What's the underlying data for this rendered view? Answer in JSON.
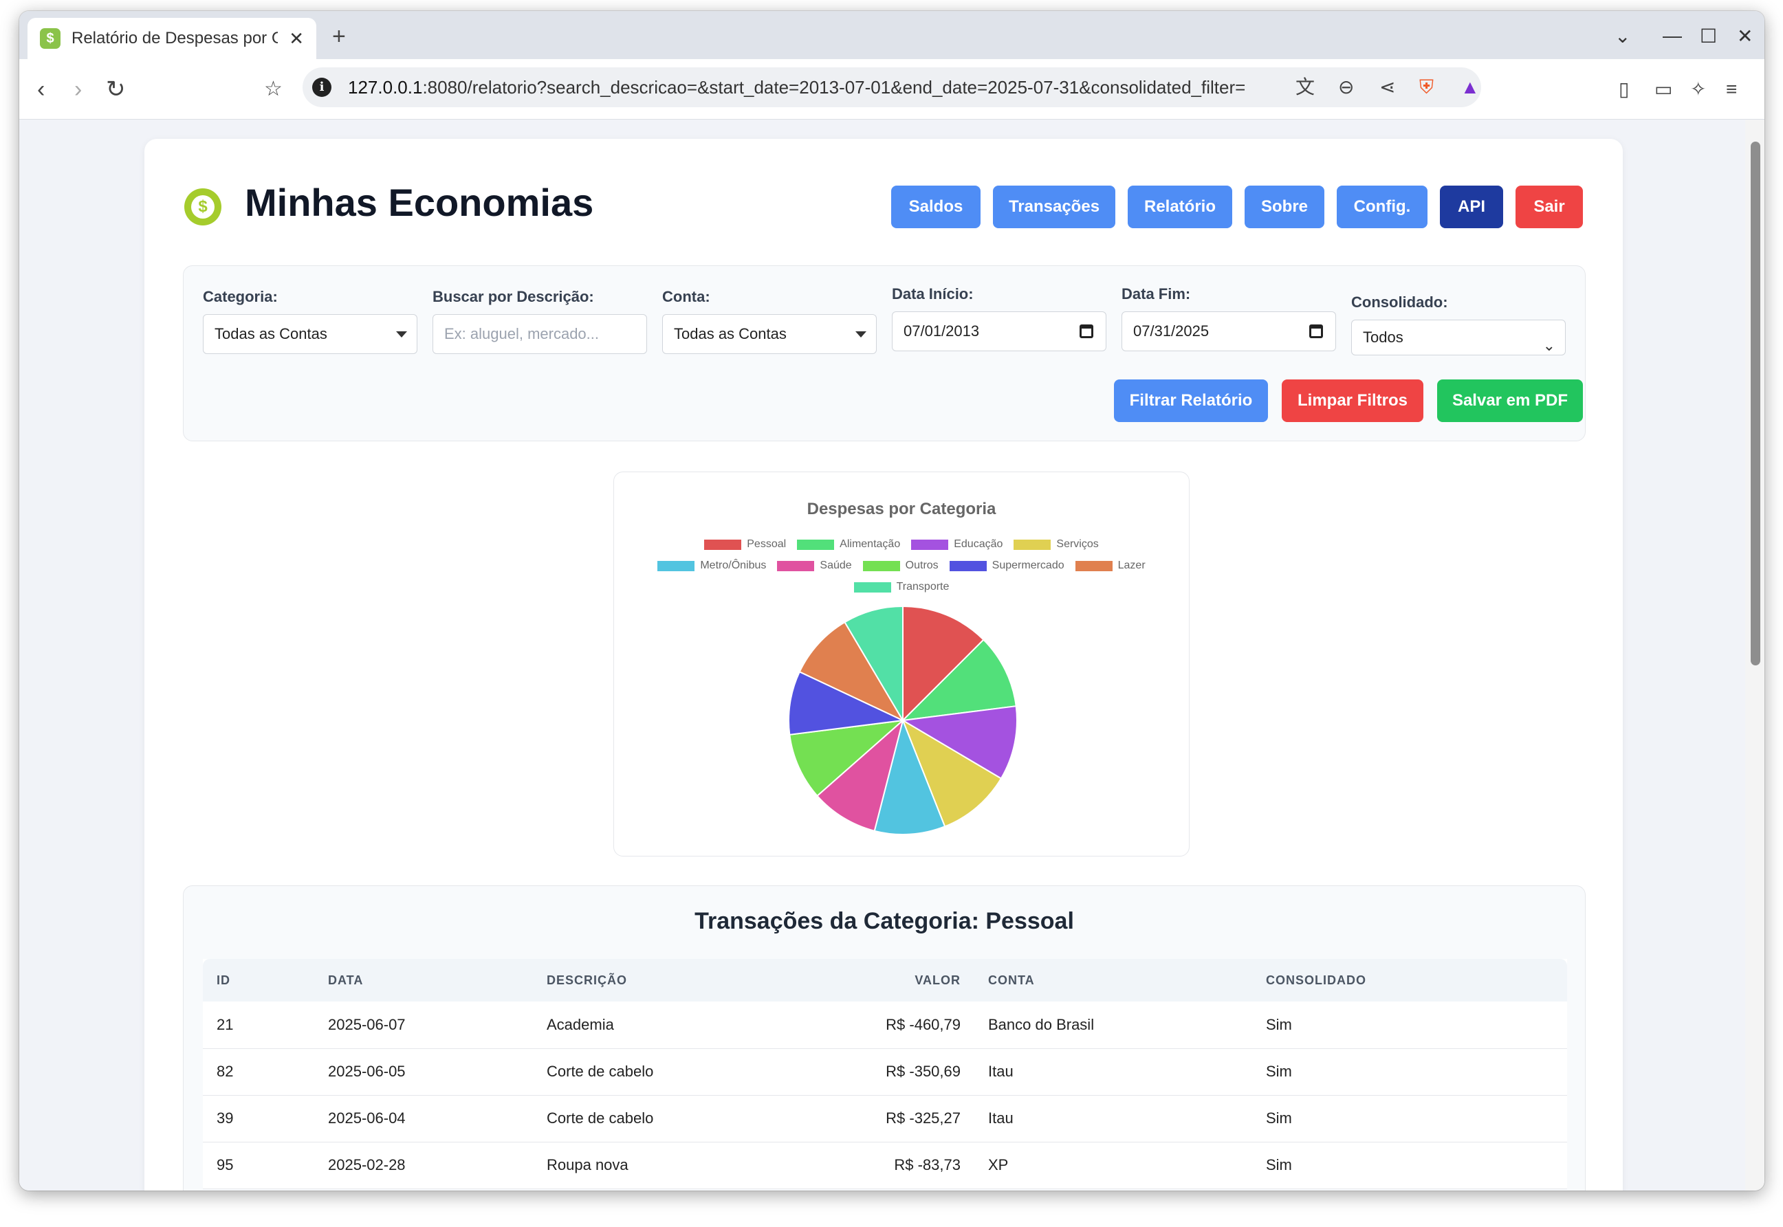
{
  "browser": {
    "tab_title": "Relatório de Despesas por C",
    "url_host": "127.0.0.1",
    "url_rest": ":8080/relatorio?search_descricao=&start_date=2013-07-01&end_date=2025-07-31&consolidated_filter="
  },
  "app": {
    "title": "Minhas Economias",
    "nav": [
      "Saldos",
      "Transações",
      "Relatório",
      "Sobre",
      "Config.",
      "API",
      "Sair"
    ]
  },
  "filters": {
    "categoria_label": "Categoria:",
    "categoria_value": "Todas as Contas",
    "busca_label": "Buscar por Descrição:",
    "busca_placeholder": "Ex: aluguel, mercado...",
    "conta_label": "Conta:",
    "conta_value": "Todas as Contas",
    "inicio_label": "Data Início:",
    "inicio_value": "07/01/2013",
    "fim_label": "Data Fim:",
    "fim_value": "07/31/2025",
    "consolidado_label": "Consolidado:",
    "consolidado_value": "Todos",
    "filtrar_button": "Filtrar Relatório",
    "limpar_button": "Limpar Filtros",
    "pdf_button": "Salvar em PDF"
  },
  "colors": {
    "primary": "#4f8df5",
    "api": "#1e3a9f",
    "danger": "#ef4444",
    "success": "#22c55e"
  },
  "chart_data": {
    "type": "pie",
    "title": "Despesas por Categoria",
    "legend_position": "top",
    "categories": [
      "Pessoal",
      "Alimentação",
      "Educação",
      "Serviços",
      "Metro/Ônibus",
      "Saúde",
      "Outros",
      "Supermercado",
      "Lazer",
      "Transporte"
    ],
    "values": [
      12.5,
      10.5,
      10.5,
      10.5,
      10.0,
      9.5,
      9.5,
      9.0,
      9.5,
      8.5
    ],
    "colors": [
      "#e05252",
      "#52e07a",
      "#a452e0",
      "#e0d052",
      "#52c4e0",
      "#e052a0",
      "#74e052",
      "#5252e0",
      "#e0804f",
      "#52e0a6"
    ]
  },
  "transactions": {
    "title": "Transações da Categoria: Pessoal",
    "headers": [
      "ID",
      "DATA",
      "DESCRIÇÃO",
      "VALOR",
      "CONTA",
      "CONSOLIDADO"
    ],
    "rows": [
      [
        "21",
        "2025-06-07",
        "Academia",
        "R$ -460,79",
        "Banco do Brasil",
        "Sim"
      ],
      [
        "82",
        "2025-06-05",
        "Corte de cabelo",
        "R$ -350,69",
        "Itau",
        "Sim"
      ],
      [
        "39",
        "2025-06-04",
        "Corte de cabelo",
        "R$ -325,27",
        "Itau",
        "Sim"
      ],
      [
        "95",
        "2025-02-28",
        "Roupa nova",
        "R$ -83,73",
        "XP",
        "Sim"
      ]
    ]
  }
}
